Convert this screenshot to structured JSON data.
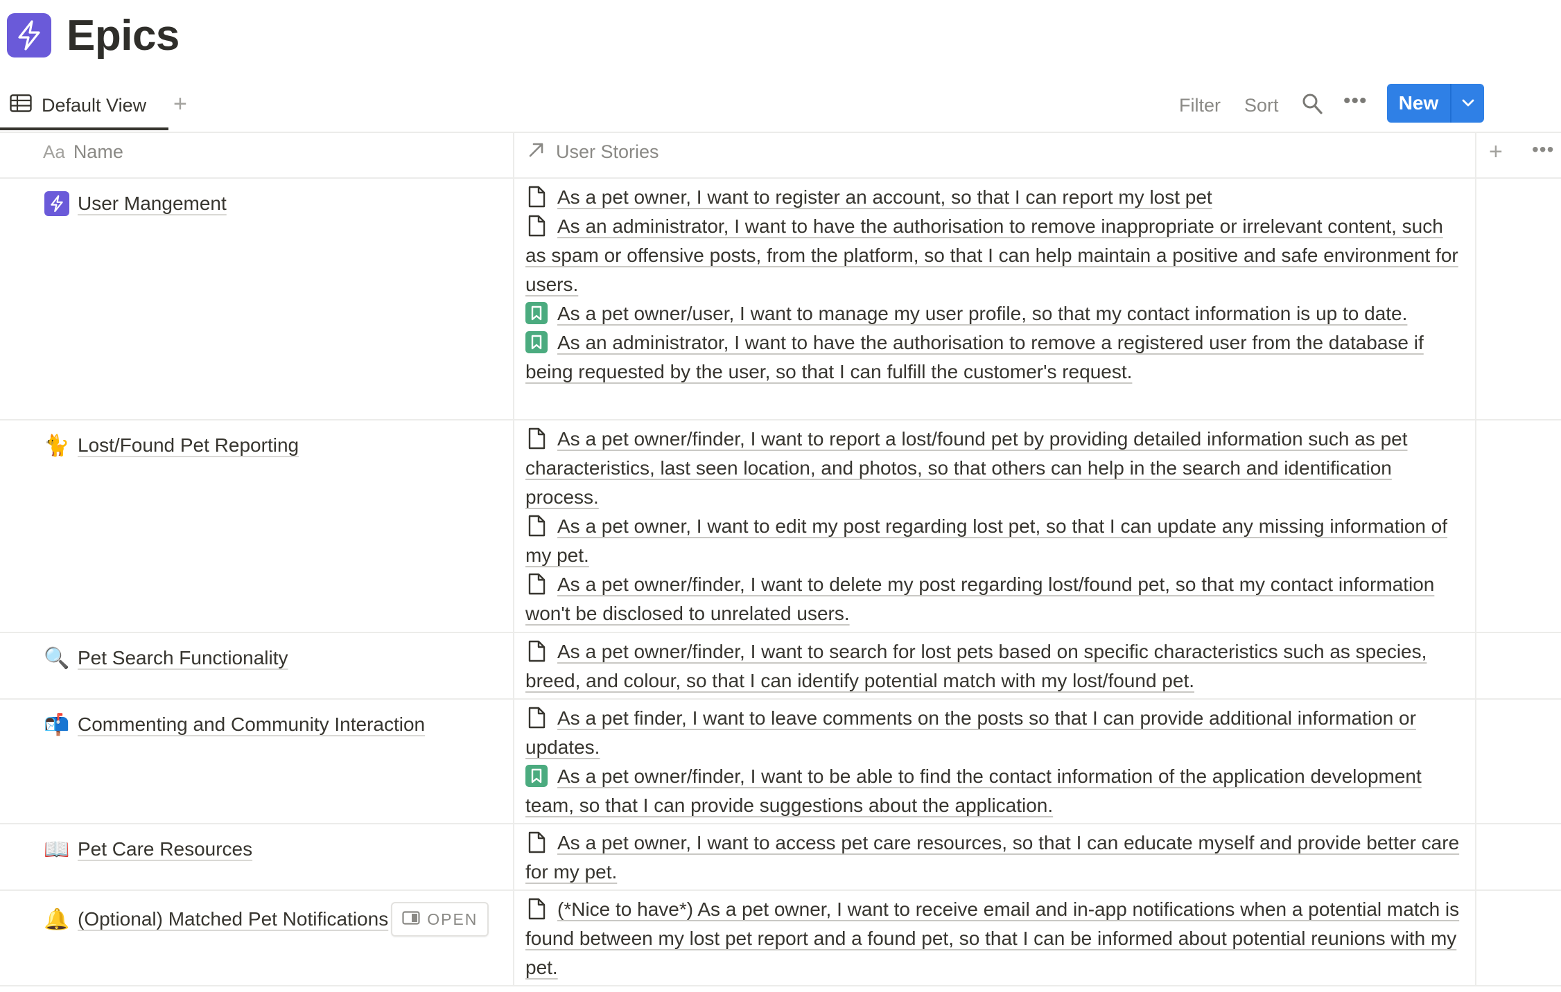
{
  "page": {
    "title": "Epics",
    "icon": "lightning-bolt-icon",
    "icon_color": "#6a5ad9"
  },
  "viewbar": {
    "tab_label": "Default View",
    "filter_label": "Filter",
    "sort_label": "Sort",
    "new_label": "New",
    "accent": "#2f80e6"
  },
  "columns": {
    "name": "Name",
    "name_prefix": "Aa",
    "stories": "User Stories"
  },
  "open_label": "OPEN",
  "rows": [
    {
      "name": "User Mangement",
      "icon": "lightning-bolt-icon",
      "stories": [
        {
          "icon": "page-icon",
          "text": "As a pet owner, I want to register an account, so that I can report my lost pet"
        },
        {
          "icon": "page-icon",
          "text": "As an administrator, I want to have the authorisation to remove inappropriate or irrelevant content, such as spam or offensive posts, from the platform, so that I can help maintain a positive and safe environment for users."
        },
        {
          "icon": "bookmark-icon",
          "text": "As a pet owner/user, I want to manage my user profile, so that my contact information is up to date."
        },
        {
          "icon": "bookmark-icon",
          "text": "As an administrator, I want to have the authorisation to remove a registered user from the database if being requested by the user, so that I can fulfill the customer's request."
        }
      ]
    },
    {
      "name": "Lost/Found Pet Reporting",
      "icon": "cat-emoji",
      "emoji": "🐈",
      "stories": [
        {
          "icon": "page-icon",
          "text": "As a pet owner/finder, I want to report a lost/found pet by providing detailed information such as pet characteristics, last seen location, and photos, so that others can help in the search and identification process."
        },
        {
          "icon": "page-icon",
          "text": "As a pet owner, I want to edit my post regarding lost pet, so that I can update any missing information of my pet."
        },
        {
          "icon": "page-icon",
          "text": "As a pet owner/finder, I want to delete my post regarding lost/found pet, so that my contact information won't be disclosed to unrelated users."
        }
      ]
    },
    {
      "name": "Pet Search Functionality",
      "icon": "magnifier-emoji",
      "emoji": "🔍",
      "stories": [
        {
          "icon": "page-icon",
          "text": "As a pet owner/finder, I want to search for lost pets based on specific characteristics such as species, breed, and colour, so that I can identify potential match with my lost/found pet."
        }
      ]
    },
    {
      "name": "Commenting and Community Interaction",
      "icon": "mailbox-emoji",
      "emoji": "📬",
      "stories": [
        {
          "icon": "page-icon",
          "text": "As a pet finder, I want to leave comments on the posts so that I can provide additional information or updates."
        },
        {
          "icon": "bookmark-icon",
          "text": "As a pet owner/finder, I want to be able to find the contact information of the application development team, so that I can provide suggestions about the application."
        }
      ]
    },
    {
      "name": "Pet Care Resources",
      "icon": "book-emoji",
      "emoji": "📖",
      "stories": [
        {
          "icon": "page-icon",
          "text": "As a pet owner, I want to access pet care resources, so that I can educate myself and provide better care for my pet."
        }
      ]
    },
    {
      "name": "(Optional) Matched Pet Notifications",
      "icon": "bell-emoji",
      "emoji": "🔔",
      "stories": [
        {
          "icon": "page-icon",
          "text": "(*Nice to have*) As a pet owner, I want to receive email and in-app notifications when a potential match is found between my lost pet report and a found pet, so that I can be informed about potential reunions with my pet."
        }
      ]
    }
  ]
}
